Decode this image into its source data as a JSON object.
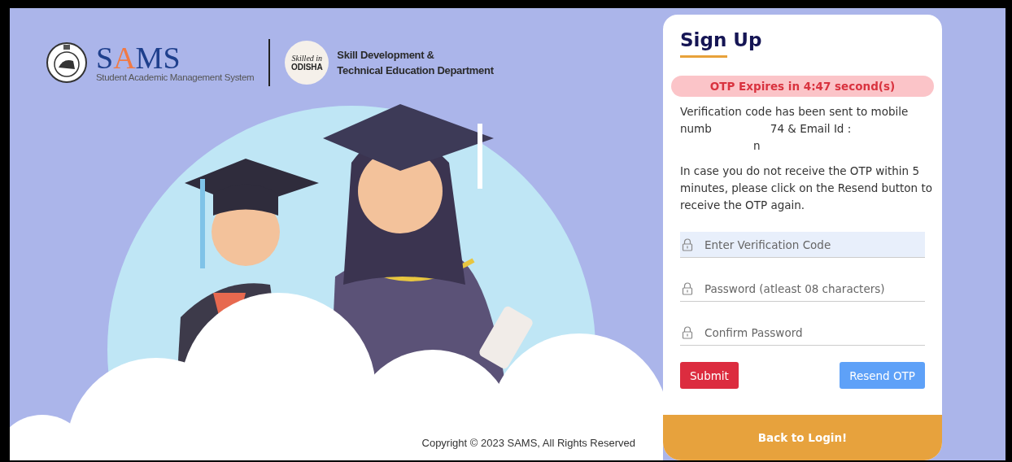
{
  "header": {
    "logo_parts": [
      {
        "text": "S",
        "accent": false
      },
      {
        "text": "A",
        "accent": true
      },
      {
        "text": "MS",
        "accent": false
      }
    ],
    "logo_subtitle": "Student Academic Management System",
    "badge_lines": [
      "Skilled in",
      "ODISHA"
    ],
    "department_lines": [
      "Skill Development &",
      "Technical Education Department"
    ]
  },
  "footer": {
    "copyright": "Copyright © 2023 SAMS, All Rights Reserved"
  },
  "card": {
    "title": "Sign Up",
    "timer": "OTP Expires in 4:47 second(s)",
    "message_lines": [
      {
        "indented": false,
        "segments": [
          "Verification code has been sent to mobile"
        ]
      },
      {
        "indented": false,
        "segments": [
          "numb",
          "74 & Email Id :"
        ]
      },
      {
        "indented": true,
        "segments": [
          "n"
        ]
      }
    ],
    "help_text": "In case you do not receive the OTP within 5 minutes, please click on the Resend button to receive the OTP again.",
    "fields": [
      {
        "placeholder": "Enter Verification Code",
        "focused": true
      },
      {
        "placeholder": "Password (atleast 08 characters)",
        "focused": false
      },
      {
        "placeholder": "Confirm Password",
        "focused": false
      }
    ],
    "buttons": [
      {
        "label": "Submit",
        "kind": "danger"
      },
      {
        "label": "Resend OTP",
        "kind": "primary"
      }
    ],
    "back_link": "Back to Login!"
  }
}
